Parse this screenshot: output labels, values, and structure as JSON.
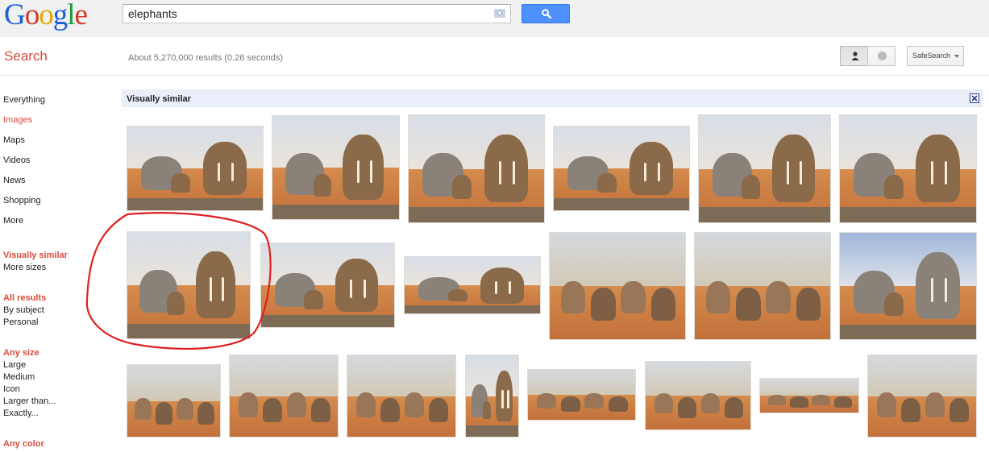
{
  "header": {
    "logo": [
      "G",
      "o",
      "o",
      "g",
      "l",
      "e"
    ],
    "logo_colors": [
      "#1a5fd6",
      "#d53a2c",
      "#e6a800",
      "#1a5fd6",
      "#1e9a3c",
      "#d53a2c"
    ],
    "query": "elephants",
    "camera_icon": "camera-icon",
    "search_icon": "magnifier-icon"
  },
  "subbar": {
    "search_label": "Search",
    "stats": "About 5,270,000 results (0.26 seconds)",
    "person_icon": "person-icon",
    "globe_icon": "globe-icon",
    "safesearch_label": "SafeSearch"
  },
  "sidebar": {
    "nav": [
      "Everything",
      "Images",
      "Maps",
      "Videos",
      "News",
      "Shopping",
      "More"
    ],
    "active": "Images",
    "visually_similar": "Visually similar",
    "more_sizes": "More sizes",
    "all_results": "All results",
    "by_subject": "By subject",
    "personal": "Personal",
    "any_size": "Any size",
    "sizes": [
      "Large",
      "Medium",
      "Icon",
      "Larger than...",
      "Exactly..."
    ],
    "any_color": "Any color"
  },
  "results": {
    "section_title": "Visually similar",
    "close_icon": "close-x-icon",
    "thumbnail_count": 20
  },
  "colors": {
    "accent_red": "#dd4b39",
    "search_blue": "#4d90fe",
    "annotation_red": "#e02020"
  }
}
